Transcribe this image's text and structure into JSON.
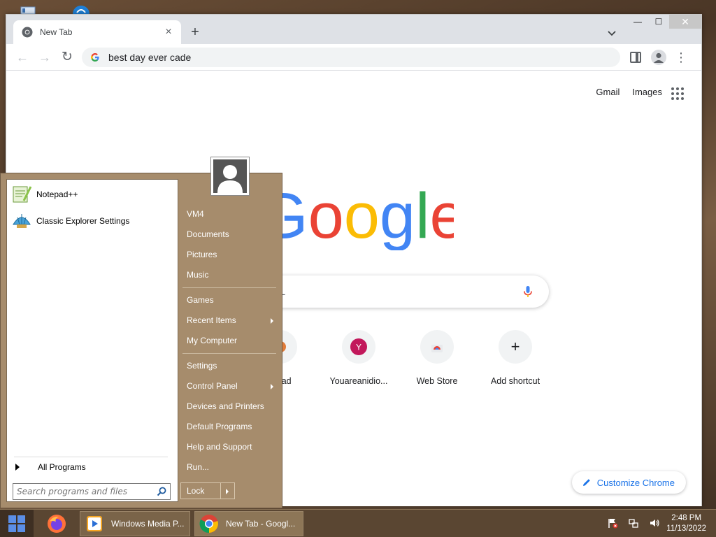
{
  "browser": {
    "tab": {
      "title": "New Tab"
    },
    "omnibox": {
      "value": "best day ever cade"
    },
    "window_controls": {
      "minimize": "—",
      "maximize": "☐",
      "close": "✕"
    }
  },
  "ntp": {
    "top_links": [
      "Gmail",
      "Images"
    ],
    "search_placeholder": "type a URL",
    "shortcuts": [
      {
        "label": "",
        "letter": "",
        "color": "#8b8b8b"
      },
      {
        "label": "...pad",
        "letter": "",
        "color": "#e07b39"
      },
      {
        "label": "Youareanidio...",
        "letter": "Y",
        "color": "#c2185b"
      },
      {
        "label": "Web Store",
        "letter": "",
        "color": "#4285f4"
      },
      {
        "label": "Add shortcut",
        "letter": "+",
        "color": "#202124"
      }
    ],
    "customize_label": "Customize Chrome",
    "logo_colors": {
      "blue": "#4285F4",
      "red": "#EA4335",
      "yellow": "#FBBC05",
      "green": "#34A853"
    }
  },
  "start_menu": {
    "pinned": [
      {
        "label": "Notepad++",
        "icon": "notepadpp-icon"
      },
      {
        "label": "Classic Explorer Settings",
        "icon": "classic-shell-icon"
      }
    ],
    "all_programs": "All Programs",
    "search_placeholder": "Search programs and files",
    "right": {
      "group1": [
        "VM4",
        "Documents",
        "Pictures",
        "Music"
      ],
      "group2": [
        "Games",
        "Recent Items",
        "My Computer"
      ],
      "group3": [
        "Settings",
        "Control Panel",
        "Devices and Printers",
        "Default Programs",
        "Help and Support",
        "Run..."
      ]
    },
    "lock_label": "Lock"
  },
  "taskbar": {
    "apps": [
      {
        "label": "Windows Media P..."
      },
      {
        "label": "New Tab - Googl..."
      }
    ],
    "clock": {
      "time": "2:48 PM",
      "date": "11/13/2022"
    }
  }
}
